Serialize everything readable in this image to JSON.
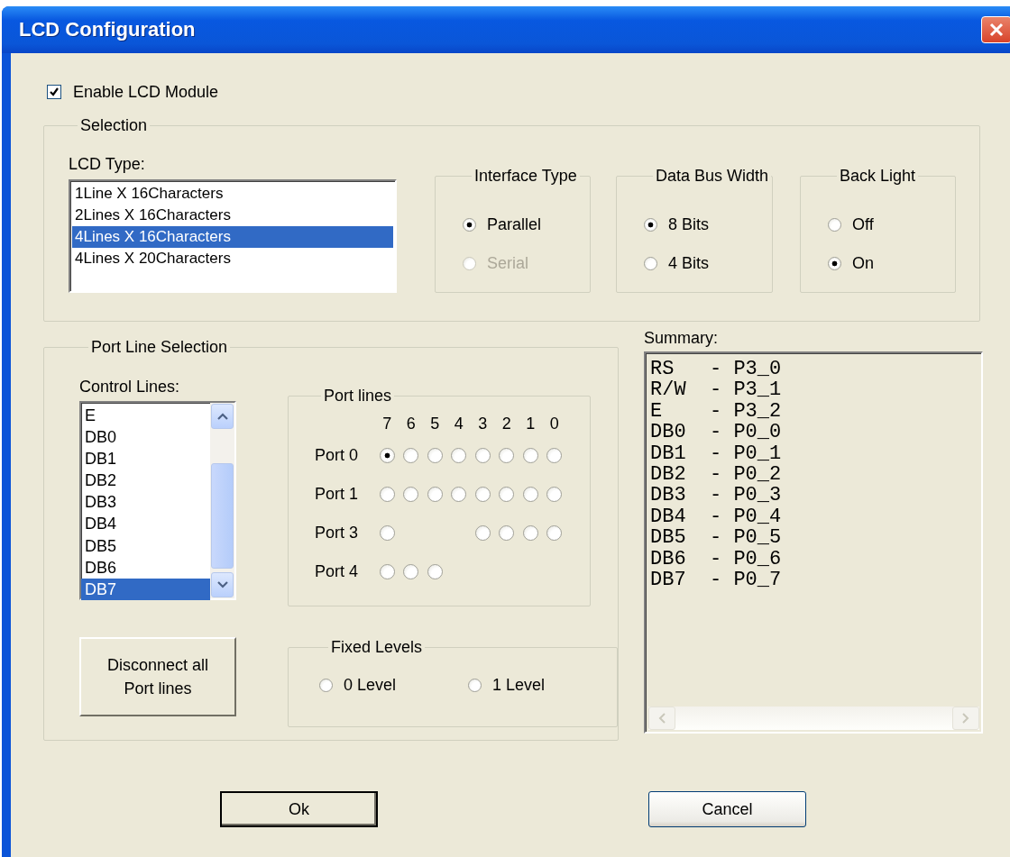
{
  "window": {
    "title": "LCD Configuration"
  },
  "enable_lcd_module": {
    "label": "Enable LCD Module",
    "checked": true
  },
  "selection": {
    "title": "Selection",
    "lcd_type": {
      "label": "LCD Type:",
      "items": [
        {
          "label": "1Line X 16Characters",
          "selected": false
        },
        {
          "label": "2Lines X 16Characters",
          "selected": false
        },
        {
          "label": "4Lines X 16Characters",
          "selected": true
        },
        {
          "label": "4Lines X 20Characters",
          "selected": false
        }
      ]
    },
    "option_groups": [
      {
        "title": "Interface Type",
        "options": [
          {
            "label": "Parallel",
            "selected": true,
            "disabled": false
          },
          {
            "label": "Serial",
            "selected": false,
            "disabled": true
          }
        ]
      },
      {
        "title": "Data Bus Width",
        "options": [
          {
            "label": "8 Bits",
            "selected": true,
            "disabled": false
          },
          {
            "label": "4 Bits",
            "selected": false,
            "disabled": false
          }
        ]
      },
      {
        "title": "Back Light",
        "options": [
          {
            "label": "Off",
            "selected": false,
            "disabled": false
          },
          {
            "label": "On",
            "selected": true,
            "disabled": false
          }
        ]
      }
    ]
  },
  "port_line_selection": {
    "title": "Port Line Selection",
    "control_lines": {
      "label": "Control Lines:",
      "items": [
        {
          "label": "E",
          "selected": false
        },
        {
          "label": "DB0",
          "selected": false
        },
        {
          "label": "DB1",
          "selected": false
        },
        {
          "label": "DB2",
          "selected": false
        },
        {
          "label": "DB3",
          "selected": false
        },
        {
          "label": "DB4",
          "selected": false
        },
        {
          "label": "DB5",
          "selected": false
        },
        {
          "label": "DB6",
          "selected": false
        },
        {
          "label": "DB7",
          "selected": true
        }
      ]
    },
    "port_lines": {
      "title": "Port lines",
      "bits": [
        "7",
        "6",
        "5",
        "4",
        "3",
        "2",
        "1",
        "0"
      ],
      "ports": [
        {
          "label": "Port 0",
          "pins": [
            {
              "kind": "radio",
              "selected": true
            },
            {
              "kind": "radio",
              "selected": false
            },
            {
              "kind": "radio",
              "selected": false
            },
            {
              "kind": "radio",
              "selected": false
            },
            {
              "kind": "radio",
              "selected": false
            },
            {
              "kind": "radio",
              "selected": false
            },
            {
              "kind": "radio",
              "selected": false
            },
            {
              "kind": "radio",
              "selected": false
            }
          ]
        },
        {
          "label": "Port 1",
          "pins": [
            {
              "kind": "radio",
              "selected": false
            },
            {
              "kind": "radio",
              "selected": false
            },
            {
              "kind": "radio",
              "selected": false
            },
            {
              "kind": "radio",
              "selected": false
            },
            {
              "kind": "radio",
              "selected": false
            },
            {
              "kind": "radio",
              "selected": false
            },
            {
              "kind": "radio",
              "selected": false
            },
            {
              "kind": "radio",
              "selected": false
            }
          ]
        },
        {
          "label": "Port 3",
          "pins": [
            {
              "kind": "radio",
              "selected": false
            },
            {
              "kind": "gap"
            },
            {
              "kind": "gap"
            },
            {
              "kind": "gap"
            },
            {
              "kind": "radio",
              "selected": false
            },
            {
              "kind": "radio",
              "selected": false
            },
            {
              "kind": "radio",
              "selected": false
            },
            {
              "kind": "radio",
              "selected": false
            }
          ]
        },
        {
          "label": "Port 4",
          "pins": [
            {
              "kind": "radio",
              "selected": false
            },
            {
              "kind": "radio",
              "selected": false
            },
            {
              "kind": "radio",
              "selected": false
            }
          ]
        }
      ]
    },
    "disconnect_button": {
      "label": "Disconnect all Port lines"
    },
    "fixed_levels": {
      "title": "Fixed Levels",
      "options": [
        {
          "label": "0 Level",
          "selected": false
        },
        {
          "label": "1 Level",
          "selected": false
        }
      ]
    }
  },
  "summary": {
    "label": "Summary:",
    "lines": [
      "RS   - P3_0",
      "R/W  - P3_1",
      "E    - P3_2",
      "DB0  - P0_0",
      "DB1  - P0_1",
      "DB2  - P0_2",
      "DB3  - P0_3",
      "DB4  - P0_4",
      "DB5  - P0_5",
      "DB6  - P0_6",
      "DB7  - P0_7"
    ]
  },
  "buttons": [
    {
      "label": "Ok",
      "default": true
    },
    {
      "label": "Cancel",
      "default": false
    }
  ]
}
